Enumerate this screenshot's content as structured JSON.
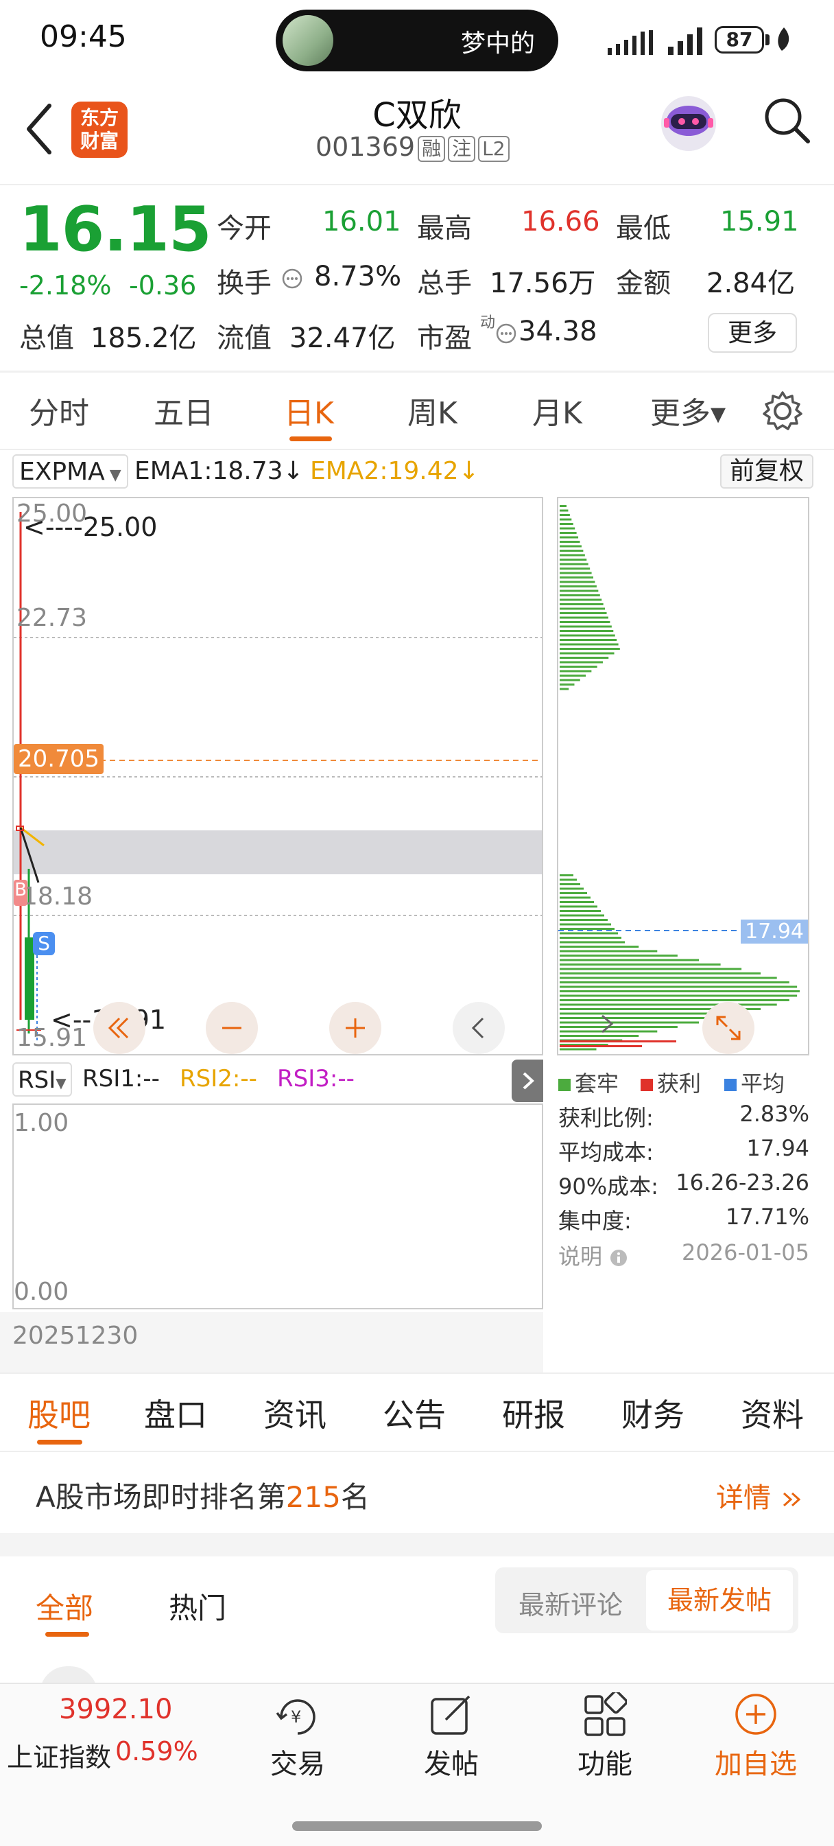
{
  "status_bar": {
    "time": "09:45",
    "island_text": "梦中的",
    "battery": "87"
  },
  "header": {
    "logo_text_1": "东方",
    "logo_text_2": "财富",
    "stock_name": "C双欣",
    "stock_code": "001369",
    "tags": [
      "融",
      "注",
      "L2"
    ]
  },
  "quote": {
    "price": "16.15",
    "change_pct": "-2.18%",
    "change_abs": "-0.36",
    "open_label": "今开",
    "open": "16.01",
    "high_label": "最高",
    "high": "16.66",
    "low_label": "最低",
    "low": "15.91",
    "turnover_label": "换手",
    "turnover": "8.73%",
    "volume_label": "总手",
    "volume": "17.56万",
    "amount_label": "金额",
    "amount": "2.84亿",
    "mktcap_label": "总值",
    "mktcap": "185.2亿",
    "float_label": "流值",
    "float": "32.47亿",
    "pe_label": "市盈",
    "pe_sup": "动",
    "pe": "34.38",
    "more_label": "更多"
  },
  "chart_tabs": [
    "分时",
    "五日",
    "日K",
    "周K",
    "月K",
    "更多▾"
  ],
  "indicator": {
    "name": "EXPMA",
    "ema1": "EMA1:18.73↓",
    "ema2": "EMA2:19.42↓",
    "adjust": "前复权"
  },
  "kline": {
    "y_labels": [
      "25.00",
      "22.73",
      "20.705",
      "18.18",
      "15.91"
    ],
    "high_marker": "<----25.00",
    "low_marker": "<--15.91",
    "s_badge": "S",
    "b_badge": "B",
    "chip_price": "17.94"
  },
  "rsi": {
    "name": "RSI",
    "rsi1": "RSI1:--",
    "rsi2": "RSI2:--",
    "rsi3": "RSI3:--",
    "top": "1.00",
    "bottom": "0.00",
    "date": "20251230"
  },
  "chip": {
    "legend": [
      "套牢",
      "获利",
      "平均"
    ],
    "legend_colors": [
      "#4cab3e",
      "#e0322b",
      "#3b82e0"
    ],
    "rows": [
      {
        "label": "获利比例:",
        "value": "2.83%"
      },
      {
        "label": "平均成本:",
        "value": "17.94"
      },
      {
        "label": "90%成本:",
        "value": "16.26-23.26"
      },
      {
        "label": "集中度:",
        "value": "17.71%"
      }
    ],
    "note_label": "说明",
    "note_date": "2026-01-05"
  },
  "bottom_tabs": [
    "股吧",
    "盘口",
    "资讯",
    "公告",
    "研报",
    "财务",
    "资料"
  ],
  "rank": {
    "prefix": "A股市场即时排名第",
    "number": "215",
    "suffix": "名",
    "detail": "详情"
  },
  "forum": {
    "all": "全部",
    "hot": "热门",
    "latest_comment": "最新评论",
    "latest_post": "最新发帖"
  },
  "bottom_bar": {
    "index_value": "3992.10",
    "index_name": "上证指数",
    "index_pct": "0.59%",
    "trade": "交易",
    "post": "发帖",
    "functions": "功能",
    "add_watch": "加自选"
  }
}
